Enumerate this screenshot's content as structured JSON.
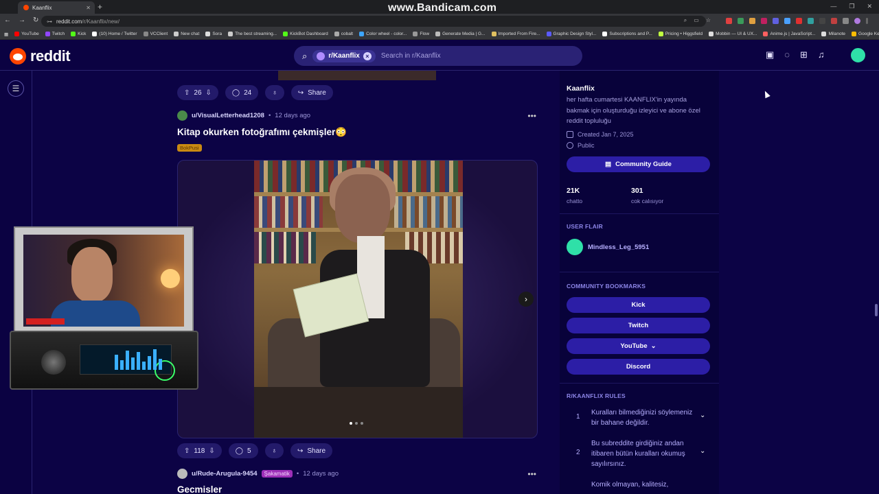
{
  "browser": {
    "tab_title": "Kaanflix",
    "new_tab": "+",
    "url_domain": "reddit.com",
    "url_path": "/r/Kaanflix/new/",
    "watermark": "www.Bandicam.com",
    "bookmarks": [
      {
        "label": "YouTube",
        "color": "#ff0000"
      },
      {
        "label": "Twitch",
        "color": "#9146ff"
      },
      {
        "label": "Kick",
        "color": "#53fc18"
      },
      {
        "label": "(10) Home / Twitter",
        "color": "#ffffff"
      },
      {
        "label": "VCClient",
        "color": "#888888"
      },
      {
        "label": "New chat",
        "color": "#cccccc"
      },
      {
        "label": "Sora",
        "color": "#dddddd"
      },
      {
        "label": "The best streaming...",
        "color": "#cccccc"
      },
      {
        "label": "KickBot Dashboard",
        "color": "#53fc18"
      },
      {
        "label": "cobalt",
        "color": "#aaaaaa"
      },
      {
        "label": "Color wheel - color...",
        "color": "#3da5ff"
      },
      {
        "label": "Flow",
        "color": "#999999"
      },
      {
        "label": "Generate Media | G...",
        "color": "#bbbbbb"
      },
      {
        "label": "Imported From Fire...",
        "color": "#e0c060"
      },
      {
        "label": "Graphic Design Styl...",
        "color": "#5a5aff"
      },
      {
        "label": "Subscriptions and P...",
        "color": "#ffffff"
      },
      {
        "label": "Pricing • Higgsfield",
        "color": "#c0ff40"
      },
      {
        "label": "Mobbin — UI & UX...",
        "color": "#dddddd"
      },
      {
        "label": "Anime.js | JavaScript...",
        "color": "#ff6060"
      },
      {
        "label": "Milanote",
        "color": "#dddddd"
      },
      {
        "label": "Google Keep",
        "color": "#fbbc04"
      }
    ]
  },
  "header": {
    "logo_text": "reddit",
    "search_chip": "r/Kaanflix",
    "search_placeholder": "Search in r/Kaanflix"
  },
  "feed": {
    "post0": {
      "upvotes": "26",
      "comments": "24",
      "share": "Share"
    },
    "post1": {
      "user": "u/VisualLetterhead1208",
      "dot": "•",
      "time": "12 days ago",
      "title": "Kitap okurken fotoğrafımı çekmişler😳",
      "flair": "BokPusi",
      "upvotes": "118",
      "comments": "5",
      "share": "Share"
    },
    "post2": {
      "user": "u/Rude-Arugula-9454",
      "flair": "Şakamatik",
      "dot": "•",
      "time": "12 days ago",
      "title": "Gecmisler"
    }
  },
  "sidebar": {
    "name": "Kaanflix",
    "description": "her hafta cumartesi KAANFLIX'in yayında bakmak için oluşturduğu izleyici ve abone özel reddit topluluğu",
    "created": "Created Jan 7, 2025",
    "visibility": "Public",
    "guide_button": "Community Guide",
    "members_value": "21K",
    "members_label": "chatto",
    "online_value": "301",
    "online_label": "cok calısıyor",
    "user_flair_head": "USER FLAIR",
    "user_flair_name": "Mindless_Leg_5951",
    "bookmarks_head": "COMMUNITY BOOKMARKS",
    "bookmarks": [
      "Kick",
      "Twitch",
      "YouTube",
      "Discord"
    ],
    "rules_head": "R/KAANFLIX RULES",
    "rules": [
      {
        "num": "1",
        "text": "Kuralları bilmediğinizi söylemeniz bir bahane değildir."
      },
      {
        "num": "2",
        "text": "Bu subreddite girdiğiniz andan itibaren bütün kuralları okumuş sayılırsınız."
      },
      {
        "num": "",
        "text": "Komik olmayan, kalitesiz,"
      }
    ]
  },
  "icons": {
    "search": "search-icon",
    "menu": "menu-icon",
    "upvote": "upvote-icon",
    "downvote": "downvote-icon",
    "comment": "comment-icon",
    "award": "award-icon",
    "share": "share-icon"
  },
  "colors": {
    "background": "#0c0345",
    "header": "#0b0242",
    "button": "#2c1ea6",
    "accent_orange": "#ff4500",
    "avatar_green": "#2fe0a8"
  }
}
